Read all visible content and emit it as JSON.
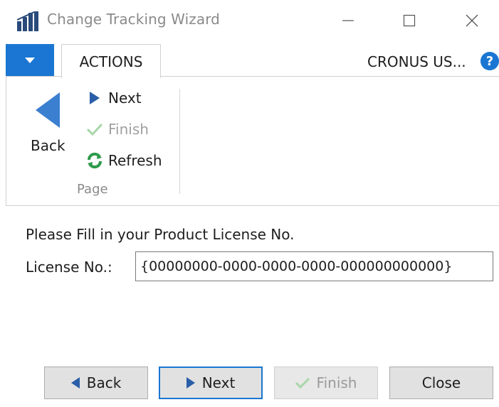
{
  "window": {
    "title": "Change Tracking Wizard",
    "icon": "dynamics-nav-icon",
    "controls": [
      "minimize-icon",
      "maximize-icon",
      "close-icon"
    ]
  },
  "ribbon": {
    "menu_icon": "dropdown-arrow-icon",
    "tab_label": "ACTIONS",
    "company": "CRONUS US...",
    "help_label": "?",
    "back_label": "Back",
    "next_label": "Next",
    "finish_label": "Finish",
    "refresh_label": "Refresh",
    "group_label": "Page"
  },
  "form": {
    "instruction": "Please Fill in your Product License No.",
    "license_label": "License No.:",
    "license_value": "{00000000-0000-0000-0000-000000000000}"
  },
  "buttons": {
    "back": "Back",
    "next": "Next",
    "finish": "Finish",
    "close": "Close"
  },
  "colors": {
    "accent": "#1a76d2",
    "disabled_text": "#a0a0a0",
    "check_disabled": "#a8d6a8",
    "refresh_green": "#2e9b4a"
  }
}
